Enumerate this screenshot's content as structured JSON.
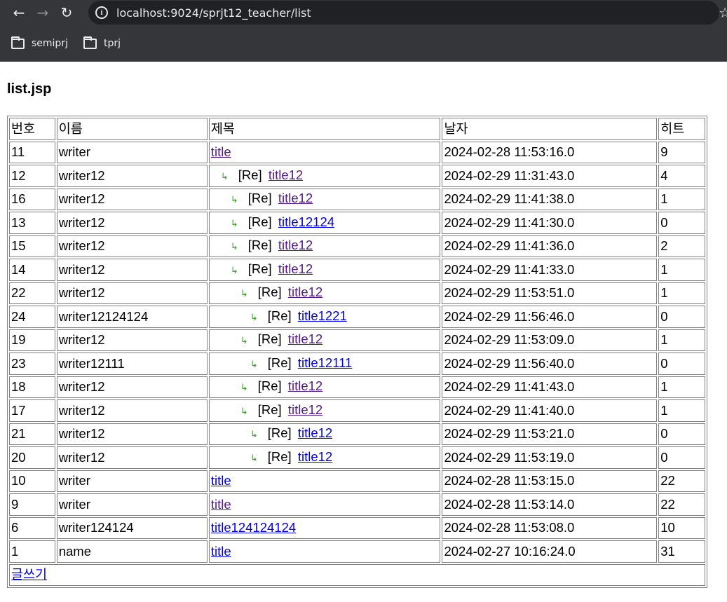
{
  "browser": {
    "back": "←",
    "forward": "→",
    "reload": "↻",
    "url": "localhost:9024/sprjt12_teacher/list",
    "star": "☆",
    "bookmarks": [
      {
        "label": "semiprj"
      },
      {
        "label": "tprj"
      }
    ]
  },
  "page": {
    "title": "list.jsp",
    "headers": [
      "번호",
      "이름",
      "제목",
      "날자",
      "히트"
    ],
    "reply_icon": "↳",
    "reply_prefix": "[Re]",
    "rows": [
      {
        "no": "11",
        "name": "writer",
        "title": "title",
        "date": "2024-02-28 11:53:16.0",
        "hit": "9",
        "depth": 0,
        "visited": true
      },
      {
        "no": "12",
        "name": "writer12",
        "title": "title12",
        "date": "2024-02-29 11:31:43.0",
        "hit": "4",
        "depth": 1,
        "visited": true
      },
      {
        "no": "16",
        "name": "writer12",
        "title": "title12",
        "date": "2024-02-29 11:41:38.0",
        "hit": "1",
        "depth": 2,
        "visited": true
      },
      {
        "no": "13",
        "name": "writer12",
        "title": "title12124",
        "date": "2024-02-29 11:41:30.0",
        "hit": "0",
        "depth": 2,
        "visited": false
      },
      {
        "no": "15",
        "name": "writer12",
        "title": "title12",
        "date": "2024-02-29 11:41:36.0",
        "hit": "2",
        "depth": 2,
        "visited": true
      },
      {
        "no": "14",
        "name": "writer12",
        "title": "title12",
        "date": "2024-02-29 11:41:33.0",
        "hit": "1",
        "depth": 2,
        "visited": true
      },
      {
        "no": "22",
        "name": "writer12",
        "title": "title12",
        "date": "2024-02-29 11:53:51.0",
        "hit": "1",
        "depth": 3,
        "visited": true
      },
      {
        "no": "24",
        "name": "writer12124124",
        "title": "title1221",
        "date": "2024-02-29 11:56:46.0",
        "hit": "0",
        "depth": 4,
        "visited": false
      },
      {
        "no": "19",
        "name": "writer12",
        "title": "title12",
        "date": "2024-02-29 11:53:09.0",
        "hit": "1",
        "depth": 3,
        "visited": true
      },
      {
        "no": "23",
        "name": "writer12111",
        "title": "title12111",
        "date": "2024-02-29 11:56:40.0",
        "hit": "0",
        "depth": 4,
        "visited": false
      },
      {
        "no": "18",
        "name": "writer12",
        "title": "title12",
        "date": "2024-02-29 11:41:43.0",
        "hit": "1",
        "depth": 3,
        "visited": true
      },
      {
        "no": "17",
        "name": "writer12",
        "title": "title12",
        "date": "2024-02-29 11:41:40.0",
        "hit": "1",
        "depth": 3,
        "visited": true
      },
      {
        "no": "21",
        "name": "writer12",
        "title": "title12",
        "date": "2024-02-29 11:53:21.0",
        "hit": "0",
        "depth": 4,
        "visited": false
      },
      {
        "no": "20",
        "name": "writer12",
        "title": "title12",
        "date": "2024-02-29 11:53:19.0",
        "hit": "0",
        "depth": 4,
        "visited": false
      },
      {
        "no": "10",
        "name": "writer",
        "title": "title",
        "date": "2024-02-28 11:53:15.0",
        "hit": "22",
        "depth": 0,
        "visited": false
      },
      {
        "no": "9",
        "name": "writer",
        "title": "title",
        "date": "2024-02-28 11:53:14.0",
        "hit": "22",
        "depth": 0,
        "visited": true
      },
      {
        "no": "6",
        "name": "writer124124",
        "title": "title124124124",
        "date": "2024-02-28 11:53:08.0",
        "hit": "10",
        "depth": 0,
        "visited": false
      },
      {
        "no": "1",
        "name": "name",
        "title": "title",
        "date": "2024-02-27 10:16:24.0",
        "hit": "31",
        "depth": 0,
        "visited": false
      }
    ],
    "write_link": "글쓰기"
  },
  "colors": {
    "chrome_bg": "#35363a",
    "omnibox_bg": "#202124",
    "link": "#0000ee",
    "visited_link": "#551a8b",
    "reply_icon": "#3f9f2f"
  }
}
